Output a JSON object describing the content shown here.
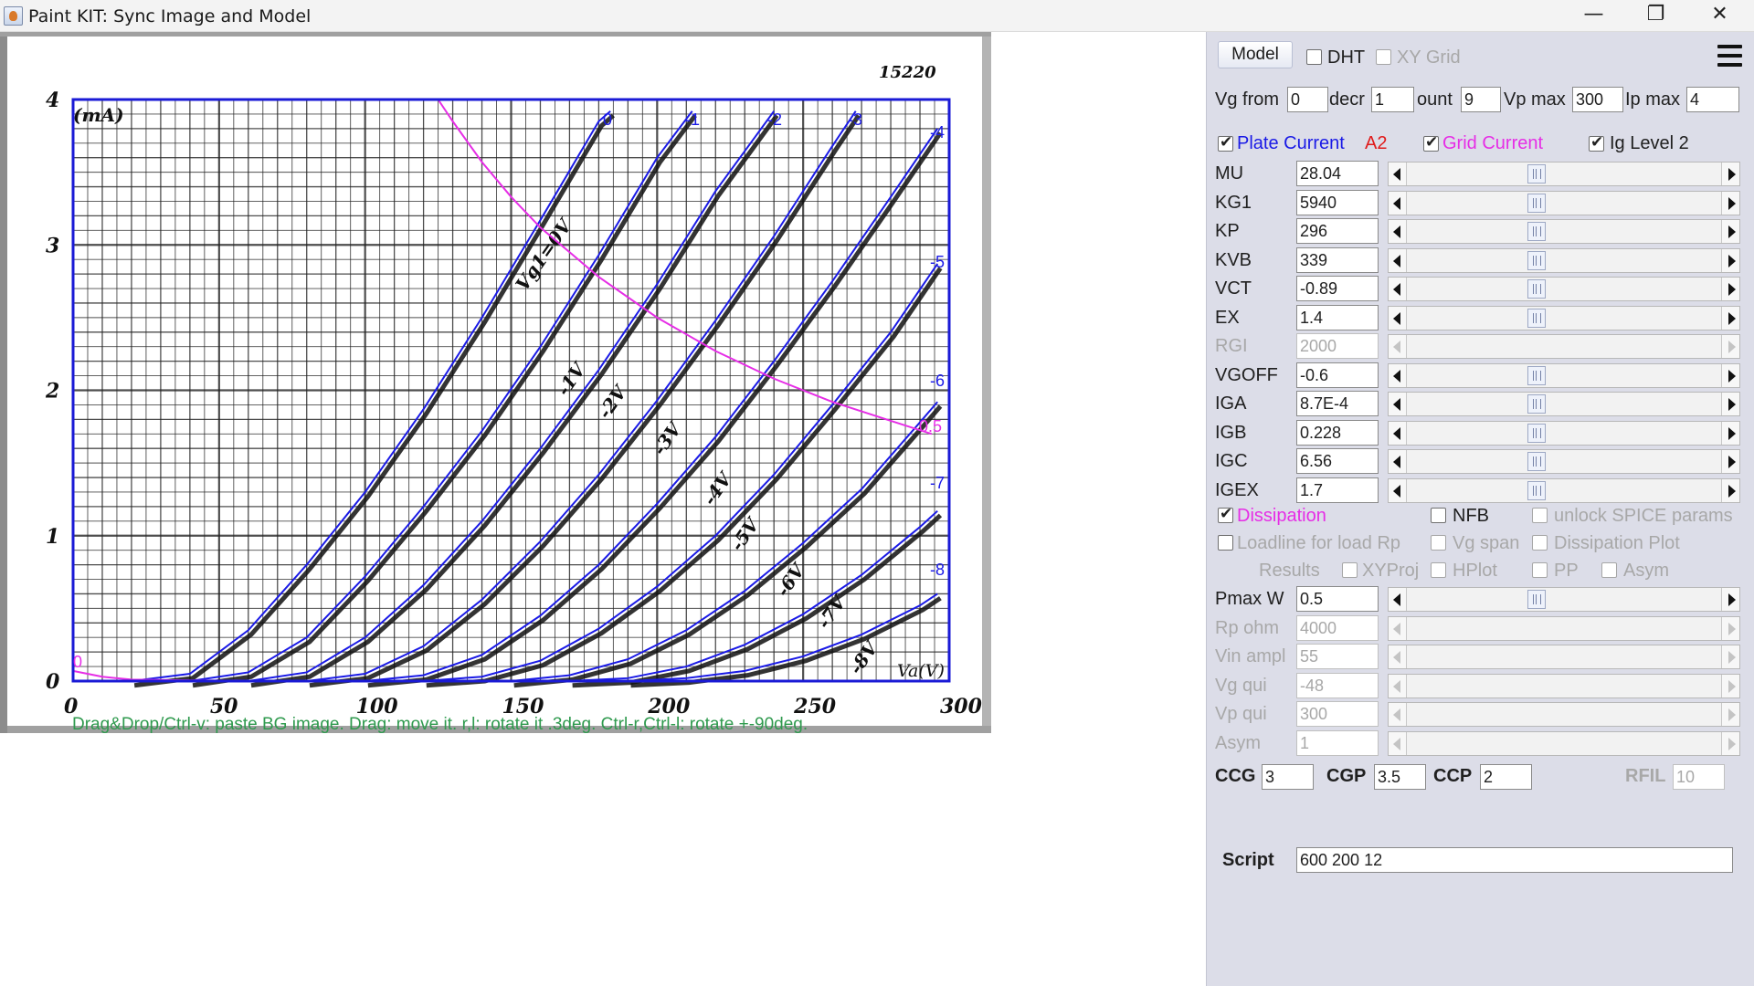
{
  "window": {
    "title": "Paint KIT: Sync Image and Model",
    "minimize": "—",
    "restore": "❐",
    "close": "✕"
  },
  "graph": {
    "corner_label": "15220",
    "y_unit_label": "mA\n(mA)",
    "x_unit_label": "Va(V)",
    "y_ticks": [
      "0",
      "1",
      "2",
      "3",
      "4"
    ],
    "x_ticks": [
      "0",
      "50",
      "100",
      "150",
      "200",
      "250",
      "300"
    ],
    "curve_labels": [
      "0",
      "-1",
      "-2",
      "-3",
      "-4",
      "-5",
      "-6",
      "-7",
      "-8"
    ],
    "dissipation_label": "0.5",
    "origin_label": "0",
    "printed_grid_labels": [
      "Vg1=0V",
      "-1V",
      "-2V",
      "-3V",
      "-4V",
      "-5V",
      "-6V",
      "-7V",
      "-8V"
    ],
    "hint": "Drag&Drop/Ctrl-v: paste BG image. Drag: move it. r,l: rotate it .3deg. Ctrl-r,Ctrl-l: rotate +-90deg.",
    "colors": {
      "frame": "#1a1ad6",
      "model_curve": "#1a1ae6",
      "dissipation": "#e62ee6",
      "image_curve": "#111111",
      "hint": "#2f9a4e"
    },
    "chart_data": {
      "type": "line",
      "xlabel": "Va(V)",
      "ylabel": "(mA)",
      "xlim": [
        0,
        300
      ],
      "ylim": [
        0,
        4
      ],
      "series": [
        {
          "name": "0",
          "x": [
            20,
            40,
            60,
            80,
            100,
            120,
            140,
            160,
            180,
            184
          ],
          "y": [
            0,
            0.05,
            0.35,
            0.8,
            1.3,
            1.87,
            2.5,
            3.17,
            3.85,
            3.92
          ]
        },
        {
          "name": "-1",
          "x": [
            40,
            60,
            80,
            100,
            120,
            140,
            160,
            180,
            200,
            212
          ],
          "y": [
            0,
            0.06,
            0.3,
            0.72,
            1.2,
            1.72,
            2.3,
            2.93,
            3.6,
            3.92
          ]
        },
        {
          "name": "-2",
          "x": [
            60,
            80,
            100,
            120,
            140,
            160,
            180,
            200,
            220,
            240
          ],
          "y": [
            0,
            0.06,
            0.3,
            0.66,
            1.1,
            1.6,
            2.14,
            2.73,
            3.37,
            3.92
          ]
        },
        {
          "name": "-3",
          "x": [
            80,
            100,
            120,
            140,
            160,
            180,
            200,
            220,
            240,
            260,
            268
          ],
          "y": [
            0,
            0.05,
            0.24,
            0.56,
            0.96,
            1.42,
            1.93,
            2.48,
            3.06,
            3.68,
            3.92
          ]
        },
        {
          "name": "-4",
          "x": [
            100,
            120,
            140,
            160,
            180,
            200,
            220,
            240,
            260,
            280,
            296
          ],
          "y": [
            0,
            0.04,
            0.18,
            0.45,
            0.8,
            1.22,
            1.68,
            2.2,
            2.75,
            3.33,
            3.8
          ]
        },
        {
          "name": "-5",
          "x": [
            120,
            140,
            160,
            180,
            200,
            220,
            240,
            260,
            280,
            296
          ],
          "y": [
            0,
            0.03,
            0.14,
            0.36,
            0.65,
            1.0,
            1.42,
            1.9,
            2.4,
            2.87
          ]
        },
        {
          "name": "-6",
          "x": [
            150,
            170,
            190,
            210,
            230,
            250,
            270,
            290,
            296
          ],
          "y": [
            0,
            0.04,
            0.15,
            0.35,
            0.62,
            0.95,
            1.32,
            1.78,
            1.92
          ]
        },
        {
          "name": "-7",
          "x": [
            170,
            190,
            210,
            230,
            250,
            270,
            290,
            296
          ],
          "y": [
            0,
            0.02,
            0.1,
            0.25,
            0.46,
            0.73,
            1.06,
            1.17
          ]
        },
        {
          "name": "-8",
          "x": [
            190,
            210,
            230,
            250,
            270,
            290,
            296
          ],
          "y": [
            0,
            0.02,
            0.07,
            0.17,
            0.32,
            0.52,
            0.6
          ]
        },
        {
          "name": "0.5",
          "x": [
            125,
            130,
            140,
            150,
            160,
            180,
            200,
            220,
            240,
            260,
            280,
            294
          ],
          "y": [
            4.0,
            3.85,
            3.57,
            3.33,
            3.12,
            2.78,
            2.5,
            2.27,
            2.08,
            1.92,
            1.79,
            1.7
          ]
        },
        {
          "name": "0",
          "x": [
            0,
            10,
            20,
            40,
            60,
            100,
            150,
            296
          ],
          "y": [
            0.07,
            0.03,
            0.01,
            0.005,
            0.003,
            0.002,
            0.002,
            0.001
          ]
        }
      ]
    }
  },
  "panel": {
    "model_button": "Model",
    "dht": "DHT",
    "xy_grid": "XY Grid",
    "vg_from_label": "Vg from",
    "vg_from": "0",
    "decr_label": "decr",
    "decr": "1",
    "count_label": "ount",
    "count": "9",
    "vp_max_label": "Vp max",
    "vp_max": "300",
    "ip_max_label": "Ip max",
    "ip_max": "4",
    "plate_current": "Plate Current",
    "a2": "A2",
    "grid_current": "Grid Current",
    "ig_level2": "Ig Level 2",
    "params": [
      {
        "label": "MU",
        "value": "28.04",
        "enabled": true
      },
      {
        "label": "KG1",
        "value": "5940",
        "enabled": true
      },
      {
        "label": "KP",
        "value": "296",
        "enabled": true
      },
      {
        "label": "KVB",
        "value": "339",
        "enabled": true
      },
      {
        "label": "VCT",
        "value": "-0.89",
        "enabled": true
      },
      {
        "label": "EX",
        "value": "1.4",
        "enabled": true
      },
      {
        "label": "RGI",
        "value": "2000",
        "enabled": false
      },
      {
        "label": "VGOFF",
        "value": "-0.6",
        "enabled": true
      },
      {
        "label": "IGA",
        "value": "8.7E-4",
        "enabled": true
      },
      {
        "label": "IGB",
        "value": "0.228",
        "enabled": true
      },
      {
        "label": "IGC",
        "value": "6.56",
        "enabled": true
      },
      {
        "label": "IGEX",
        "value": "1.7",
        "enabled": true
      }
    ],
    "dissipation": "Dissipation",
    "nfb": "NFB",
    "unlock_spice": "unlock SPICE params",
    "loadline": "Loadline for load Rp",
    "vg_span": "Vg span",
    "dissipation_plot": "Dissipation Plot",
    "results": "Results",
    "xyproj": "XYProj",
    "hplot": "HPlot",
    "pp": "PP",
    "asym_cb": "Asym",
    "params2": [
      {
        "label": "Pmax W",
        "value": "0.5",
        "enabled": true
      },
      {
        "label": "Rp ohm",
        "value": "4000",
        "enabled": false
      },
      {
        "label": "Vin ampl",
        "value": "55",
        "enabled": false
      },
      {
        "label": "Vg qui",
        "value": "-48",
        "enabled": false
      },
      {
        "label": "Vp qui",
        "value": "300",
        "enabled": false
      },
      {
        "label": "Asym",
        "value": "1",
        "enabled": false
      }
    ],
    "ccg_label": "CCG",
    "ccg": "3",
    "cgp_label": "CGP",
    "cgp": "3.5",
    "ccp_label": "CCP",
    "ccp": "2",
    "rfil_label": "RFIL",
    "rfil": "10",
    "script_label": "Script",
    "script": "600 200 12",
    "colors": {
      "plate_current": "#1a1ae6",
      "a2": "#e01b1b",
      "grid_current": "#e62ee6",
      "dissipation": "#e62ee6"
    }
  }
}
